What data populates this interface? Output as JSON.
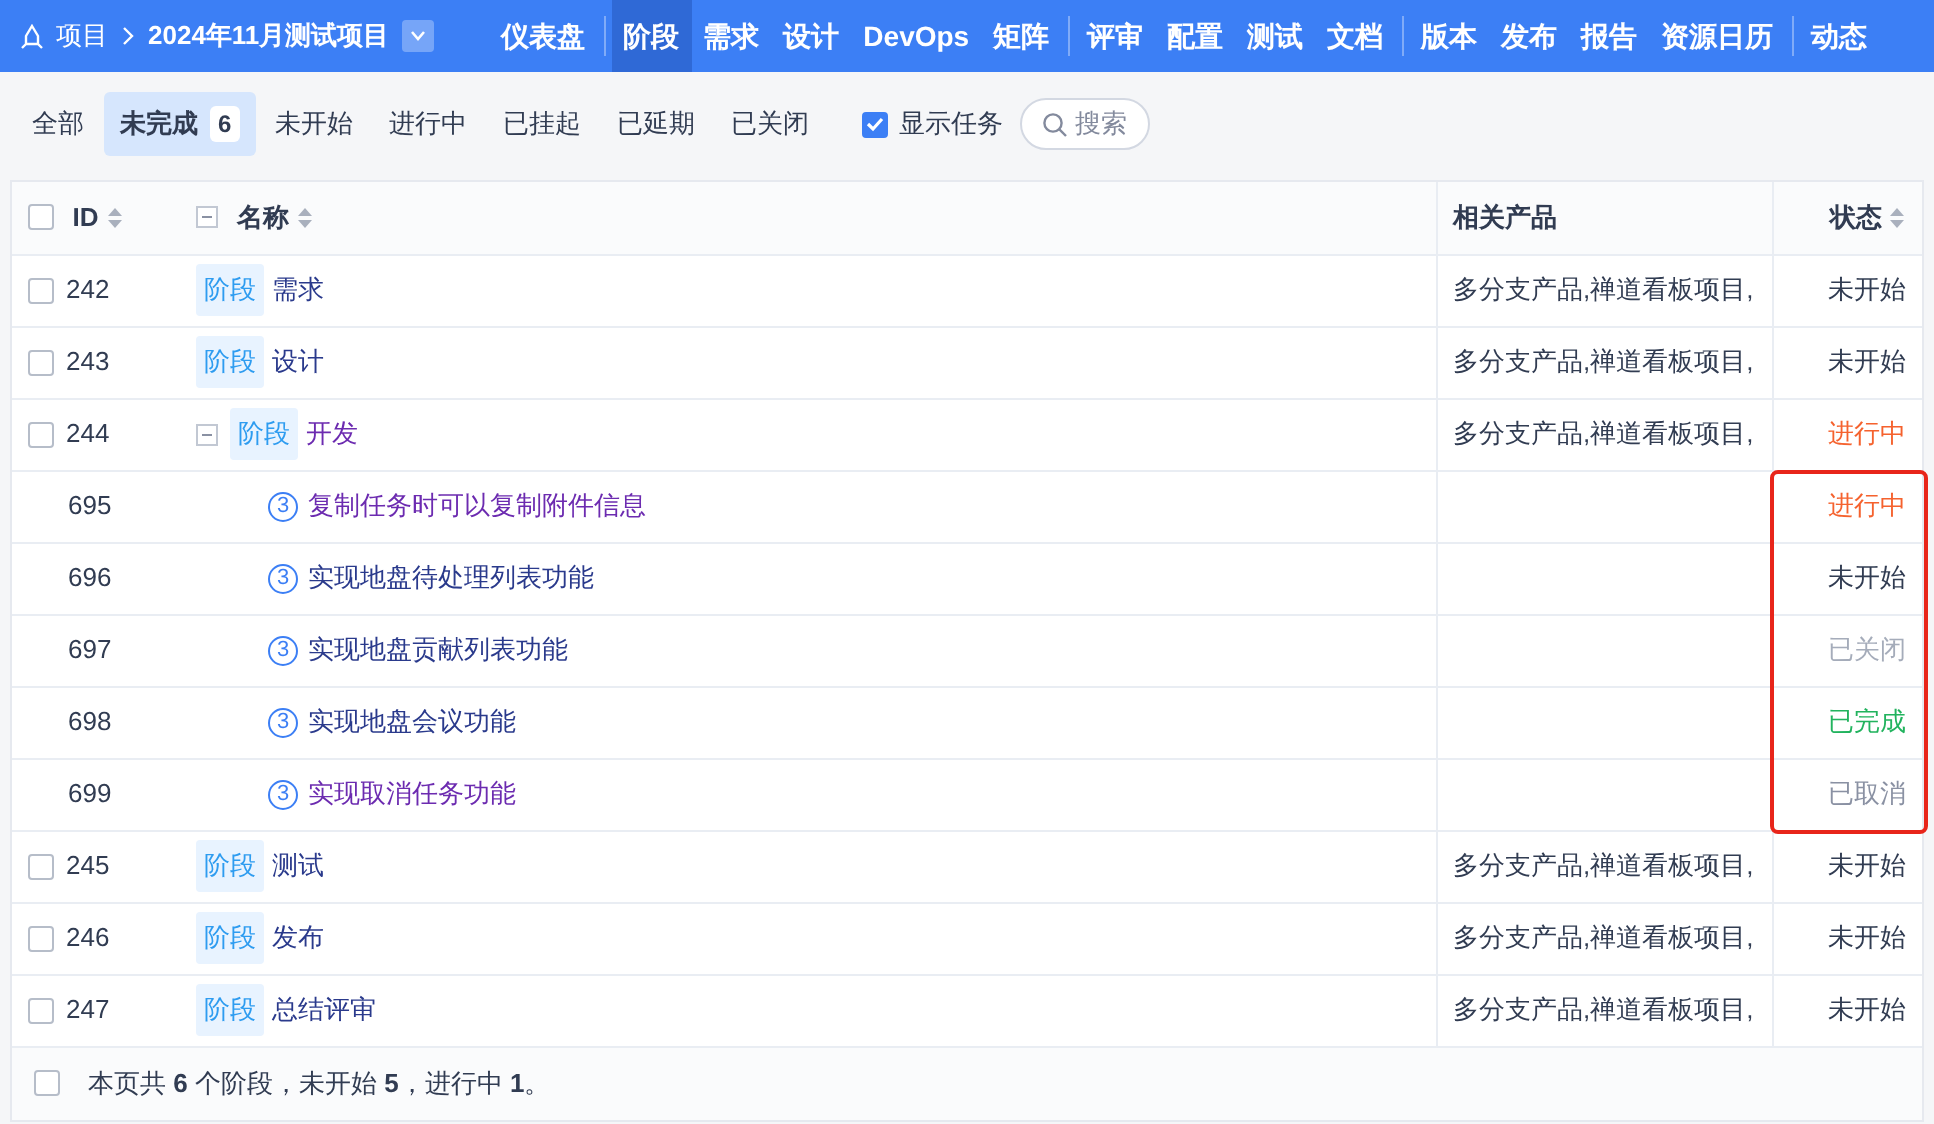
{
  "navbar": {
    "section": "项目",
    "project": "2024年11月测试项目",
    "groups": [
      [
        {
          "label": "仪表盘",
          "selected": false
        }
      ],
      [
        {
          "label": "阶段",
          "selected": true
        },
        {
          "label": "需求",
          "selected": false
        },
        {
          "label": "设计",
          "selected": false
        },
        {
          "label": "DevOps",
          "selected": false
        },
        {
          "label": "矩阵",
          "selected": false
        }
      ],
      [
        {
          "label": "评审",
          "selected": false
        },
        {
          "label": "配置",
          "selected": false
        },
        {
          "label": "测试",
          "selected": false
        },
        {
          "label": "文档",
          "selected": false
        }
      ],
      [
        {
          "label": "版本",
          "selected": false
        },
        {
          "label": "发布",
          "selected": false
        },
        {
          "label": "报告",
          "selected": false
        },
        {
          "label": "资源日历",
          "selected": false
        }
      ],
      [
        {
          "label": "动态",
          "selected": false
        }
      ]
    ]
  },
  "filters": [
    {
      "label": "全部",
      "selected": false
    },
    {
      "label": "未完成",
      "count": "6",
      "selected": true
    },
    {
      "label": "未开始",
      "selected": false
    },
    {
      "label": "进行中",
      "selected": false
    },
    {
      "label": "已挂起",
      "selected": false
    },
    {
      "label": "已延期",
      "selected": false
    },
    {
      "label": "已关闭",
      "selected": false
    }
  ],
  "show_tasks": {
    "label": "显示任务",
    "checked": true
  },
  "search": {
    "placeholder": "搜索"
  },
  "table": {
    "select_all_checked": false,
    "columns": [
      "ID",
      "名称",
      "相关产品",
      "状态"
    ],
    "rows": [
      {
        "kind": "stage",
        "id": "242",
        "tag": "阶段",
        "name": "需求",
        "visited": false,
        "product": "多分支产品,禅道看板项目,",
        "status": "未开始",
        "color": "#313c52",
        "checked": false
      },
      {
        "kind": "stage",
        "id": "243",
        "tag": "阶段",
        "name": "设计",
        "visited": false,
        "product": "多分支产品,禅道看板项目,",
        "status": "未开始",
        "color": "#313c52",
        "checked": false
      },
      {
        "kind": "stage",
        "id": "244",
        "tag": "阶段",
        "name": "开发",
        "visited": true,
        "product": "多分支产品,禅道看板项目,",
        "status": "进行中",
        "color": "#f5622e",
        "checked": false,
        "expanded": true,
        "children": [
          {
            "kind": "task",
            "id": "695",
            "priority": "3",
            "name": "复制任务时可以复制附件信息",
            "visited": true,
            "status": "进行中",
            "color": "#f5622e",
            "highlighted": true
          },
          {
            "kind": "task",
            "id": "696",
            "priority": "3",
            "name": "实现地盘待处理列表功能",
            "visited": false,
            "status": "未开始",
            "color": "#313c52",
            "highlighted": true
          },
          {
            "kind": "task",
            "id": "697",
            "priority": "3",
            "name": "实现地盘贡献列表功能",
            "visited": false,
            "status": "已关闭",
            "color": "#a5acba",
            "highlighted": true
          },
          {
            "kind": "task",
            "id": "698",
            "priority": "3",
            "name": "实现地盘会议功能",
            "visited": false,
            "status": "已完成",
            "color": "#22b35e",
            "highlighted": true
          },
          {
            "kind": "task",
            "id": "699",
            "priority": "3",
            "name": "实现取消任务功能",
            "visited": true,
            "status": "已取消",
            "color": "#8a91a3",
            "highlighted": true
          }
        ]
      },
      {
        "kind": "stage",
        "id": "245",
        "tag": "阶段",
        "name": "测试",
        "visited": false,
        "product": "多分支产品,禅道看板项目,",
        "status": "未开始",
        "color": "#313c52",
        "checked": false
      },
      {
        "kind": "stage",
        "id": "246",
        "tag": "阶段",
        "name": "发布",
        "visited": false,
        "product": "多分支产品,禅道看板项目,",
        "status": "未开始",
        "color": "#313c52",
        "checked": false
      },
      {
        "kind": "stage",
        "id": "247",
        "tag": "阶段",
        "name": "总结评审",
        "visited": false,
        "product": "多分支产品,禅道看板项目,",
        "status": "未开始",
        "color": "#313c52",
        "checked": false
      }
    ]
  },
  "footer": {
    "checked": false,
    "summary": "本页共 **6** 个阶段，未开始 **5**，进行中 **1**。"
  }
}
